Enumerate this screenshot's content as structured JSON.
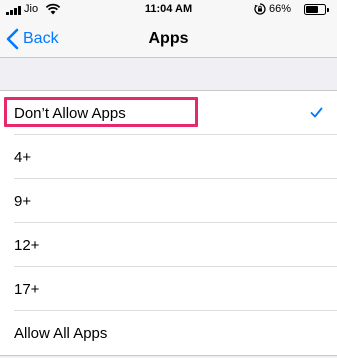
{
  "status_bar": {
    "carrier": "Jio",
    "time": "11:04 AM",
    "battery_percent": "66%",
    "battery_level": 0.66,
    "icons": [
      "signal-icon",
      "wifi-icon",
      "rotation-lock-icon",
      "battery-icon"
    ]
  },
  "nav": {
    "back_label": "Back",
    "title": "Apps"
  },
  "options": [
    {
      "label": "Don’t Allow Apps",
      "selected": true
    },
    {
      "label": "4+",
      "selected": false
    },
    {
      "label": "9+",
      "selected": false
    },
    {
      "label": "12+",
      "selected": false
    },
    {
      "label": "17+",
      "selected": false
    },
    {
      "label": "Allow All Apps",
      "selected": false
    }
  ],
  "colors": {
    "accent": "#007aff",
    "highlight": "#e6286c",
    "background": "#efeff4"
  }
}
